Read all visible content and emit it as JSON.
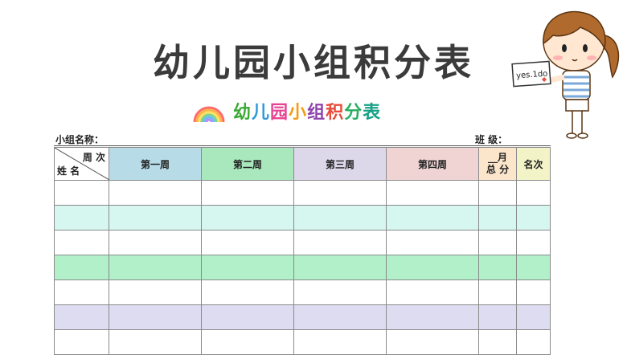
{
  "title": "幼儿园小组积分表",
  "subtitle": "幼儿园小组积分表",
  "subtitle_colors": [
    "#3aaa35",
    "#2e9ad8",
    "#e84393",
    "#f39c12",
    "#8e44ad",
    "#e74c3c",
    "#27ae60",
    "#16a085"
  ],
  "girl_sign": "yes.1do",
  "info": {
    "group_label": "小组名称：",
    "class_label": "班  级："
  },
  "table": {
    "corner_top": "周 次",
    "corner_bottom": "姓 名",
    "headers": [
      "第一周",
      "第二周",
      "第三周",
      "第四周"
    ],
    "month_label_line1": "__月",
    "month_label_line2": "总 分",
    "rank_label": "名次",
    "header_colors": [
      "#b7dce8",
      "#a9e8bd",
      "#dcd8ea",
      "#f0d4d4",
      "#fbe6cc",
      "#f2f4c8"
    ],
    "row_colors": [
      "#ffffff",
      "#d6f6f0",
      "#ffffff",
      "#b1f0c9",
      "#ffffff",
      "#dedcf0",
      "#ffffff"
    ]
  }
}
